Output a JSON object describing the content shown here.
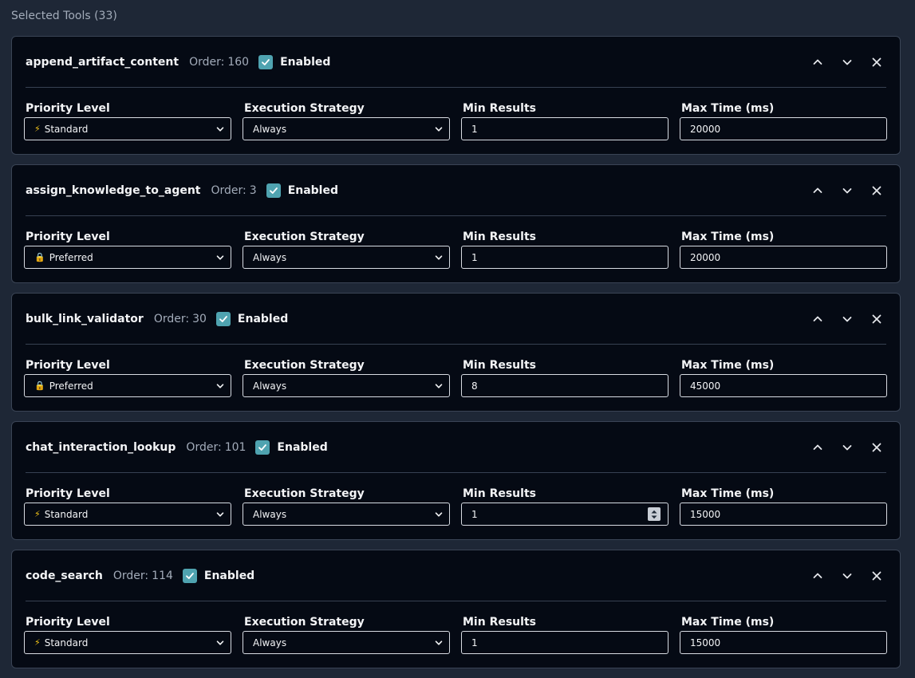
{
  "title": "Selected Tools (33)",
  "labels": {
    "order_prefix": "Order:",
    "enabled": "Enabled",
    "priority_level": "Priority Level",
    "execution_strategy": "Execution Strategy",
    "min_results": "Min Results",
    "max_time": "Max Time (ms)"
  },
  "colors": {
    "background": "#1e2736",
    "card_background": "#050a14",
    "checkbox_accent": "#4fa3b0"
  },
  "tools": [
    {
      "name": "append_artifact_content",
      "order": "160",
      "enabled": true,
      "priority": {
        "icon": "lightning-icon",
        "glyph": "⚡",
        "label": "Standard"
      },
      "strategy": "Always",
      "min_results": "1",
      "max_time": "20000"
    },
    {
      "name": "assign_knowledge_to_agent",
      "order": "3",
      "enabled": true,
      "priority": {
        "icon": "lock-icon",
        "glyph": "🔒",
        "label": "Preferred"
      },
      "strategy": "Always",
      "min_results": "1",
      "max_time": "20000"
    },
    {
      "name": "bulk_link_validator",
      "order": "30",
      "enabled": true,
      "priority": {
        "icon": "lock-icon",
        "glyph": "🔒",
        "label": "Preferred"
      },
      "strategy": "Always",
      "min_results": "8",
      "max_time": "45000"
    },
    {
      "name": "chat_interaction_lookup",
      "order": "101",
      "enabled": true,
      "priority": {
        "icon": "lightning-icon",
        "glyph": "⚡",
        "label": "Standard"
      },
      "strategy": "Always",
      "min_results": "1",
      "max_time": "15000",
      "min_results_focused": true
    },
    {
      "name": "code_search",
      "order": "114",
      "enabled": true,
      "priority": {
        "icon": "lightning-icon",
        "glyph": "⚡",
        "label": "Standard"
      },
      "strategy": "Always",
      "min_results": "1",
      "max_time": "15000"
    }
  ]
}
